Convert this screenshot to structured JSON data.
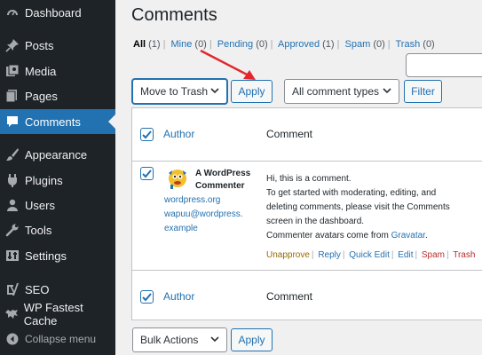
{
  "sidebar": {
    "items": [
      {
        "label": "Dashboard",
        "icon": "dashboard-icon"
      },
      {
        "label": "Posts",
        "icon": "pin-icon"
      },
      {
        "label": "Media",
        "icon": "media-icon"
      },
      {
        "label": "Pages",
        "icon": "pages-icon"
      },
      {
        "label": "Comments",
        "icon": "comment-bubble-icon",
        "active": true
      },
      {
        "label": "Appearance",
        "icon": "paintbrush-icon"
      },
      {
        "label": "Plugins",
        "icon": "plugin-icon"
      },
      {
        "label": "Users",
        "icon": "user-icon"
      },
      {
        "label": "Tools",
        "icon": "wrench-icon"
      },
      {
        "label": "Settings",
        "icon": "settings-icon"
      },
      {
        "label": "SEO",
        "icon": "yoast-icon"
      },
      {
        "label": "WP Fastest Cache",
        "icon": "cheetah-icon"
      },
      {
        "label": "Collapse menu",
        "icon": "collapse-icon"
      }
    ]
  },
  "page": {
    "title": "Comments"
  },
  "filters": [
    {
      "label": "All",
      "count": "(1)",
      "current": true
    },
    {
      "label": "Mine",
      "count": "(0)"
    },
    {
      "label": "Pending",
      "count": "(0)"
    },
    {
      "label": "Approved",
      "count": "(1)"
    },
    {
      "label": "Spam",
      "count": "(0)"
    },
    {
      "label": "Trash",
      "count": "(0)"
    }
  ],
  "toolbar_top": {
    "bulk_action_selected": "Move to Trash",
    "apply_label": "Apply",
    "comment_type_selected": "All comment types",
    "filter_label": "Filter"
  },
  "table": {
    "header_author": "Author",
    "header_comment": "Comment",
    "footer_author": "Author",
    "footer_comment": "Comment",
    "row": {
      "author_name": "A WordPress Commenter",
      "author_url": "wordpress.org",
      "author_email_line1": "wapuu@wordpress.",
      "author_email_line2": "example",
      "comment_line1": "Hi, this is a comment.",
      "comment_line2": "To get started with moderating, editing, and",
      "comment_line3": "deleting comments, please visit the Comments",
      "comment_line4": "screen in the dashboard.",
      "comment_line5": "Commenter avatars come from ",
      "comment_link": "Gravatar",
      "comment_end": ".",
      "actions": {
        "unapprove": "Unapprove",
        "reply": "Reply",
        "quick_edit": "Quick Edit",
        "edit": "Edit",
        "spam": "Spam",
        "trash": "Trash"
      }
    }
  },
  "toolbar_bottom": {
    "bulk_action_selected": "Bulk Actions",
    "apply_label": "Apply"
  },
  "colors": {
    "sidebar_bg": "#1d2327",
    "accent": "#2271b1",
    "annotation_arrow": "#e3262d"
  }
}
